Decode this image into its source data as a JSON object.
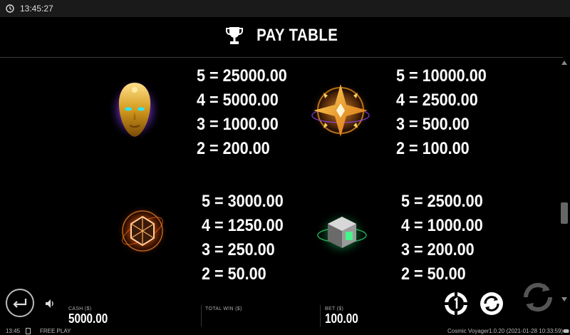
{
  "status_bar": {
    "time": "13:45:27",
    "clock_icon": "clock-icon"
  },
  "header": {
    "title": "PAY TABLE",
    "icon": "trophy-icon"
  },
  "paytable": [
    {
      "symbol": "golden-mask",
      "icon": "golden-mask-icon",
      "lines": [
        "5 = 25000.00",
        "4 = 5000.00",
        "3 = 1000.00",
        "2 = 200.00"
      ]
    },
    {
      "symbol": "compass-star",
      "icon": "compass-star-icon",
      "lines": [
        "5 = 10000.00",
        "4 = 2500.00",
        "3 = 500.00",
        "2 = 100.00"
      ]
    },
    {
      "symbol": "orange-crystal",
      "icon": "orange-crystal-icon",
      "lines": [
        "5 = 3000.00",
        "4 = 1250.00",
        "3 = 250.00",
        "2 = 50.00"
      ]
    },
    {
      "symbol": "green-cube",
      "icon": "green-cube-icon",
      "lines": [
        "5 = 2500.00",
        "4 = 1000.00",
        "3 = 200.00",
        "2 = 50.00"
      ]
    }
  ],
  "bottom_bar": {
    "cash_label": "CASH ($)",
    "cash_value": "5000.00",
    "total_win_label": "TOTAL WIN ($)",
    "bet_label": "BET ($)",
    "bet_value": "100.00"
  },
  "footer": {
    "time": "13:45",
    "mode": "FREE PLAY",
    "game_name": "Cosmic Voyager",
    "version": "1.0.20 (2021-01-28 10:33:59)"
  },
  "colors": {
    "background": "#000000",
    "text": "#ffffff",
    "gold": "#d4a017",
    "orange": "#ff7a1a",
    "green": "#2bd46a"
  }
}
